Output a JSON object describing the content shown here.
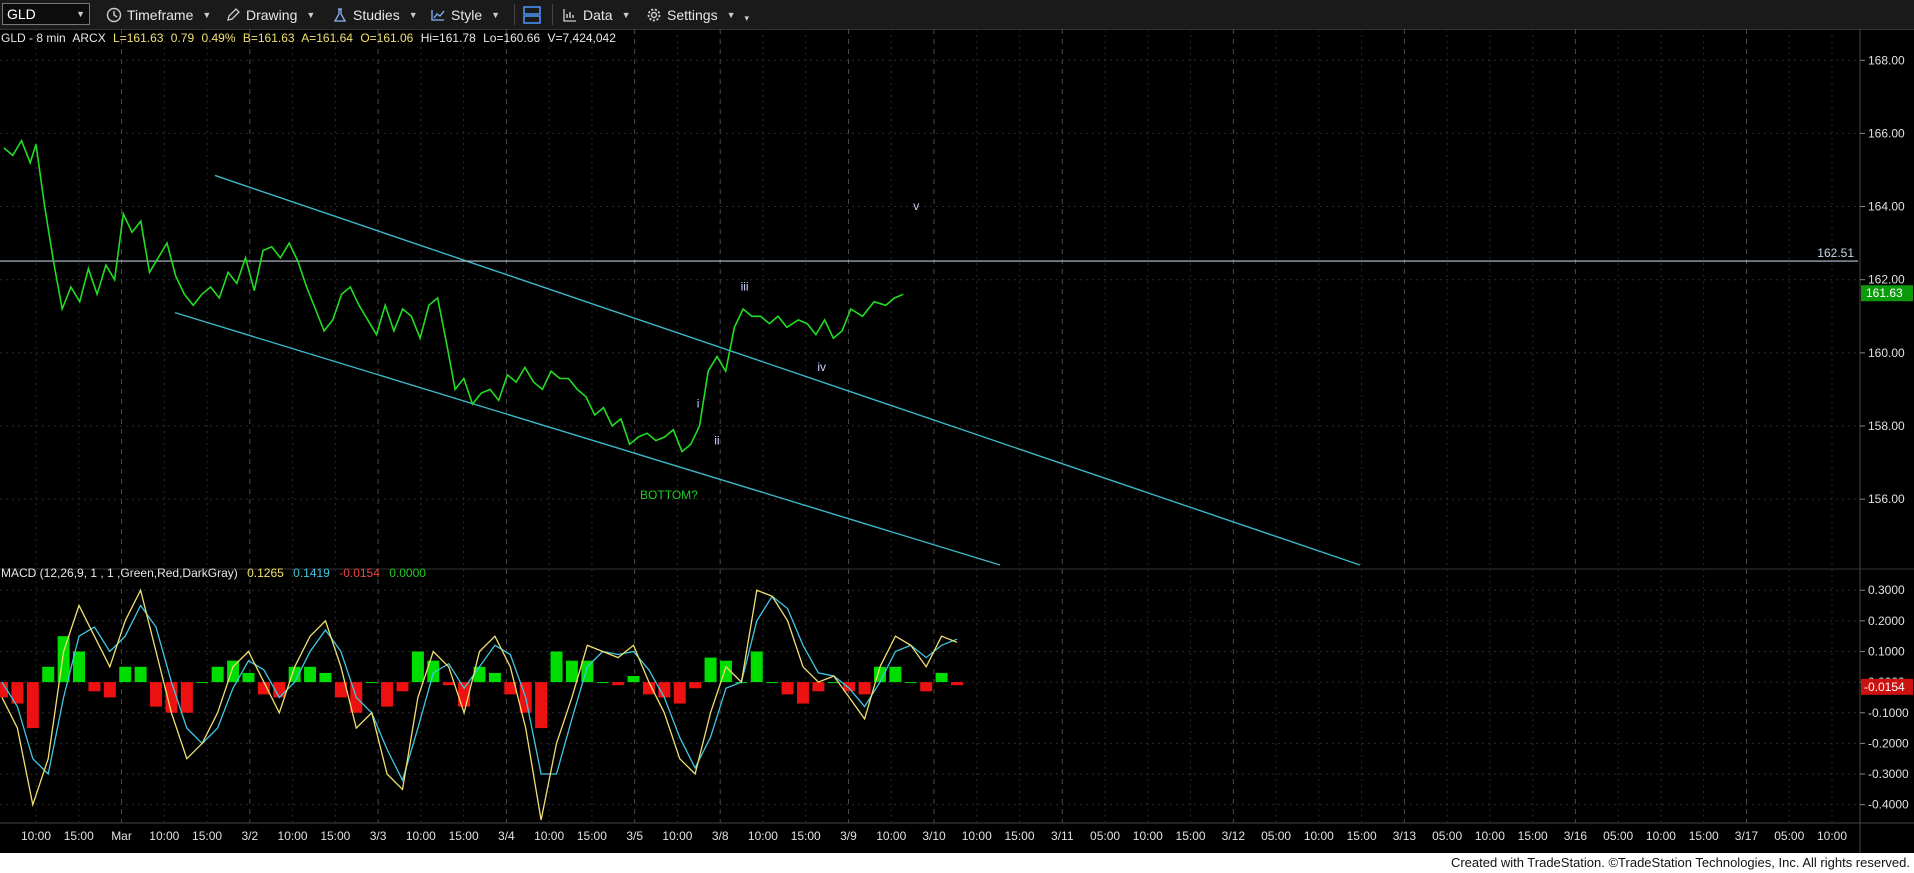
{
  "toolbar": {
    "symbol": "GLD",
    "timeframe": "Timeframe",
    "drawing": "Drawing",
    "studies": "Studies",
    "style": "Style",
    "data": "Data",
    "settings": "Settings"
  },
  "info": {
    "symbol_line": "GLD - 8 min",
    "exchange": "ARCX",
    "last": "L=161.63",
    "change": "0.79",
    "change_pct": "0.49%",
    "bid": "B=161.63",
    "ask": "A=161.64",
    "open": "O=161.06",
    "high": "Hi=161.78",
    "low": "Lo=160.66",
    "volume": "V=7,424,042"
  },
  "macd_info": {
    "label": "MACD (12,26,9, 1 , 1 ,Green,Red,DarkGray)",
    "macd": "0.1265",
    "signal": "0.1419",
    "diff": "-0.0154",
    "zero": "0.0000"
  },
  "footer": {
    "text": "Created with TradeStation. ©TradeStation Technologies, Inc. All rights reserved."
  },
  "colors": {
    "price": "#22dd22",
    "channel": "#3bb8c8",
    "hline": "#b8c8d8",
    "macd_line": "#f0e070",
    "signal_line": "#40c8e0",
    "hist_pos": "#00dd00",
    "hist_neg": "#ee1111",
    "grid": "#2a2a2a",
    "axis_text": "#e0e0e0",
    "label_green": "#22cc22"
  },
  "chart_data": [
    {
      "type": "line",
      "title": "GLD - 8 min",
      "x_axis_labels": [
        "10:00",
        "15:00",
        "Mar",
        "10:00",
        "15:00",
        "3/2",
        "10:00",
        "15:00",
        "3/3",
        "10:00",
        "15:00",
        "3/4",
        "10:00",
        "15:00",
        "3/5",
        "10:00",
        "3/8",
        "10:00",
        "15:00",
        "3/9",
        "10:00",
        "3/10",
        "10:00",
        "15:00",
        "3/11",
        "05:00",
        "10:00",
        "15:00",
        "3/12",
        "05:00",
        "10:00",
        "15:00",
        "3/13",
        "05:00",
        "10:00",
        "15:00",
        "3/16",
        "05:00",
        "10:00",
        "15:00",
        "3/17",
        "05:00",
        "10:00"
      ],
      "y_ticks": [
        "168.00",
        "166.00",
        "164.00",
        "162.00",
        "160.00",
        "158.00",
        "156.00"
      ],
      "ylim": [
        154.2,
        168.8
      ],
      "last_price_label": "161.63",
      "horizontal_line": {
        "value": 162.51,
        "label": "162.51"
      },
      "series": [
        {
          "x_bar": [
            0,
            6,
            12,
            18,
            22,
            28,
            34,
            40,
            46,
            52,
            58,
            64,
            70,
            76,
            82,
            88,
            94,
            100,
            106,
            112,
            118,
            124,
            130,
            136,
            142,
            148,
            154,
            160,
            166,
            172,
            178,
            184,
            190,
            196,
            202,
            208,
            214,
            220,
            226,
            232,
            238,
            244,
            250,
            256,
            262,
            268,
            274,
            280,
            286,
            292,
            298,
            304,
            310,
            316,
            322,
            328,
            334,
            340,
            346,
            352,
            358,
            364,
            370,
            376,
            382,
            388,
            394,
            400,
            406,
            412,
            418,
            424,
            430,
            436,
            442,
            448,
            454,
            460,
            466,
            472,
            478,
            484,
            490,
            496,
            502,
            508,
            514,
            520,
            526,
            532,
            538,
            546,
            552,
            558,
            564,
            570,
            576,
            582,
            590,
            598,
            606,
            612,
            618,
            624,
            630,
            636,
            642,
            648,
            654
          ],
          "close": [
            165.6,
            165.4,
            165.8,
            165.2,
            165.7,
            164.0,
            162.5,
            161.2,
            161.8,
            161.4,
            162.3,
            161.6,
            162.4,
            162.0,
            163.8,
            163.3,
            163.6,
            162.2,
            162.6,
            163.0,
            162.1,
            161.6,
            161.3,
            161.6,
            161.8,
            161.5,
            162.2,
            161.9,
            162.6,
            161.7,
            162.8,
            162.9,
            162.6,
            163.0,
            162.5,
            161.8,
            161.2,
            160.6,
            160.9,
            161.6,
            161.8,
            161.3,
            160.9,
            160.5,
            161.3,
            160.6,
            161.2,
            161.0,
            160.4,
            161.3,
            161.5,
            160.3,
            159.0,
            159.3,
            158.6,
            158.9,
            159.0,
            158.7,
            159.4,
            159.2,
            159.6,
            159.2,
            159.0,
            159.5,
            159.3,
            159.3,
            159.0,
            158.8,
            158.3,
            158.5,
            158.0,
            158.2,
            157.5,
            157.7,
            157.8,
            157.6,
            157.7,
            157.9,
            157.3,
            157.5,
            158.0,
            159.5,
            159.9,
            159.5,
            160.7,
            161.2,
            161.0,
            161.0,
            160.8,
            161.0,
            160.7,
            160.9,
            160.8,
            160.5,
            160.9,
            160.4,
            160.6,
            161.2,
            161.0,
            161.4,
            161.3,
            161.5,
            161.6
          ]
        }
      ],
      "annotations": [
        {
          "text": "i",
          "x_bar": 477,
          "y": 158.5
        },
        {
          "text": "ii",
          "x_bar": 490,
          "y": 157.5
        },
        {
          "text": "iii",
          "x_bar": 509,
          "y": 161.7
        },
        {
          "text": "iv",
          "x_bar": 562,
          "y": 159.5
        },
        {
          "text": "v",
          "x_bar": 627,
          "y": 163.9
        },
        {
          "text": "BOTTOM?",
          "x_bar": 457,
          "y": 156.0,
          "color": "green"
        }
      ]
    },
    {
      "type": "line",
      "title": "MACD (12,26,9, 1 , 1 ,Green,Red,DarkGray)",
      "y_ticks": [
        "0.3000",
        "0.2000",
        "0.1000",
        "0.0000",
        "-0.1000",
        "-0.2000",
        "-0.3000",
        "-0.4000"
      ],
      "ylim": [
        -0.45,
        0.33
      ],
      "last_value_label": "-0.0154",
      "series": [
        {
          "name": "MACD",
          "values": [
            -0.05,
            -0.15,
            -0.4,
            -0.25,
            0.1,
            0.25,
            0.15,
            0.05,
            0.2,
            0.3,
            0.1,
            -0.1,
            -0.25,
            -0.2,
            -0.1,
            0.05,
            0.1,
            0.0,
            -0.1,
            0.05,
            0.15,
            0.2,
            0.05,
            -0.15,
            -0.1,
            -0.3,
            -0.35,
            -0.05,
            0.1,
            0.05,
            -0.1,
            0.1,
            0.15,
            0.05,
            -0.15,
            -0.45,
            -0.2,
            -0.05,
            0.12,
            0.1,
            0.08,
            0.12,
            0.0,
            -0.1,
            -0.25,
            -0.3,
            -0.1,
            0.05,
            0.0,
            0.3,
            0.28,
            0.2,
            0.05,
            0.0,
            0.02,
            -0.05,
            -0.12,
            0.05,
            0.15,
            0.12,
            0.05,
            0.15,
            0.13
          ]
        },
        {
          "name": "Signal",
          "values": [
            0.0,
            -0.08,
            -0.25,
            -0.3,
            -0.05,
            0.15,
            0.18,
            0.1,
            0.15,
            0.25,
            0.18,
            0.0,
            -0.15,
            -0.2,
            -0.15,
            -0.02,
            0.07,
            0.04,
            -0.05,
            0.0,
            0.1,
            0.17,
            0.1,
            -0.05,
            -0.1,
            -0.22,
            -0.32,
            -0.15,
            0.03,
            0.06,
            -0.02,
            0.05,
            0.12,
            0.09,
            -0.05,
            -0.3,
            -0.3,
            -0.12,
            0.05,
            0.1,
            0.09,
            0.1,
            0.04,
            -0.05,
            -0.18,
            -0.28,
            -0.18,
            -0.02,
            0.0,
            0.2,
            0.28,
            0.24,
            0.12,
            0.03,
            0.02,
            -0.02,
            -0.08,
            0.0,
            0.1,
            0.12,
            0.08,
            0.12,
            0.14
          ]
        }
      ]
    }
  ]
}
